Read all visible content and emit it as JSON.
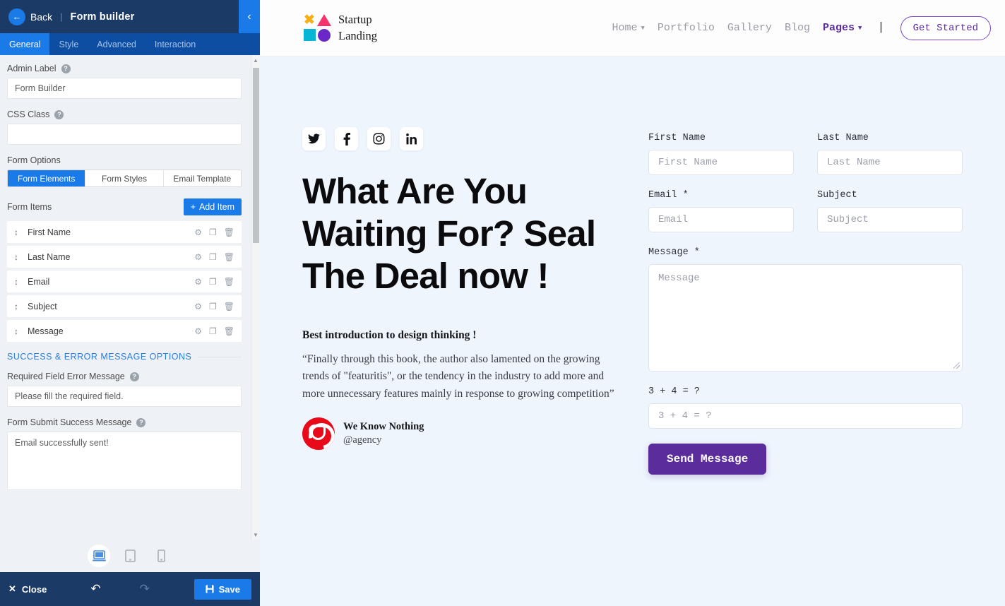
{
  "sidebar": {
    "header": {
      "back_label": "Back",
      "separator": "|",
      "title": "Form builder",
      "collapse_icon": "‹"
    },
    "tabs": [
      {
        "label": "General",
        "active": true
      },
      {
        "label": "Style",
        "active": false
      },
      {
        "label": "Advanced",
        "active": false
      },
      {
        "label": "Interaction",
        "active": false
      }
    ],
    "admin_label": {
      "label": "Admin Label",
      "value": "Form Builder",
      "help": "?"
    },
    "css_class": {
      "label": "CSS Class",
      "value": "",
      "help": "?"
    },
    "form_options": {
      "label": "Form Options",
      "segments": [
        {
          "label": "Form Elements",
          "active": true
        },
        {
          "label": "Form Styles",
          "active": false
        },
        {
          "label": "Email Template",
          "active": false
        }
      ]
    },
    "form_items": {
      "label": "Form Items",
      "add_button": "Add Item",
      "add_icon": "+",
      "items": [
        {
          "name": "First Name"
        },
        {
          "name": "Last Name"
        },
        {
          "name": "Email"
        },
        {
          "name": "Subject"
        },
        {
          "name": "Message"
        }
      ]
    },
    "messages_section": {
      "title": "SUCCESS & ERROR MESSAGE OPTIONS",
      "error_label": "Required Field Error Message",
      "error_value": "Please fill the required field.",
      "success_label": "Form Submit Success Message",
      "success_value": "Email successfully sent!"
    },
    "devices": [
      {
        "name": "desktop",
        "active": true
      },
      {
        "name": "tablet",
        "active": false
      },
      {
        "name": "mobile",
        "active": false
      }
    ],
    "footer": {
      "close_label": "Close",
      "close_icon": "✕",
      "undo_icon": "↶",
      "redo_icon": "↷",
      "save_label": "Save",
      "save_icon": "💾"
    }
  },
  "preview": {
    "nav": {
      "logo_line1": "Startup",
      "logo_line2": "Landing",
      "links": [
        {
          "label": "Home",
          "caret": true,
          "current": false
        },
        {
          "label": "Portfolio",
          "caret": false,
          "current": false
        },
        {
          "label": "Gallery",
          "caret": false,
          "current": false
        },
        {
          "label": "Blog",
          "caret": false,
          "current": false
        },
        {
          "label": "Pages",
          "caret": true,
          "current": true
        }
      ],
      "divider": "|",
      "cta": "Get Started"
    },
    "hero": {
      "socials": [
        "twitter-icon",
        "facebook-icon",
        "instagram-icon",
        "linkedin-icon"
      ],
      "title": "What Are You Waiting For? Seal The Deal now !",
      "quote_heading": "Best introduction to design thinking !",
      "quote_body": "“Finally through this book, the author also lamented on the growing trends of \"featuritis\", or the tendency in the industry to add more and more unnecessary features mainly in response to growing competition”",
      "author_name": "We Know Nothing",
      "author_handle": "@agency"
    },
    "form": {
      "first_name": {
        "label": "First Name",
        "placeholder": "First Name"
      },
      "last_name": {
        "label": "Last Name",
        "placeholder": "Last Name"
      },
      "email": {
        "label": "Email *",
        "placeholder": "Email"
      },
      "subject": {
        "label": "Subject",
        "placeholder": "Subject"
      },
      "message": {
        "label": "Message *",
        "placeholder": "Message"
      },
      "captcha": {
        "label": "3 + 4 = ?",
        "placeholder": "3 + 4 = ?"
      },
      "submit": "Send Message"
    }
  },
  "colors": {
    "sidebar_header": "#1b3a66",
    "accent_blue": "#1a7ae8",
    "tab_bar": "#0d4da2",
    "purple": "#5b2c9c",
    "preview_bg": "#eef5fd"
  }
}
